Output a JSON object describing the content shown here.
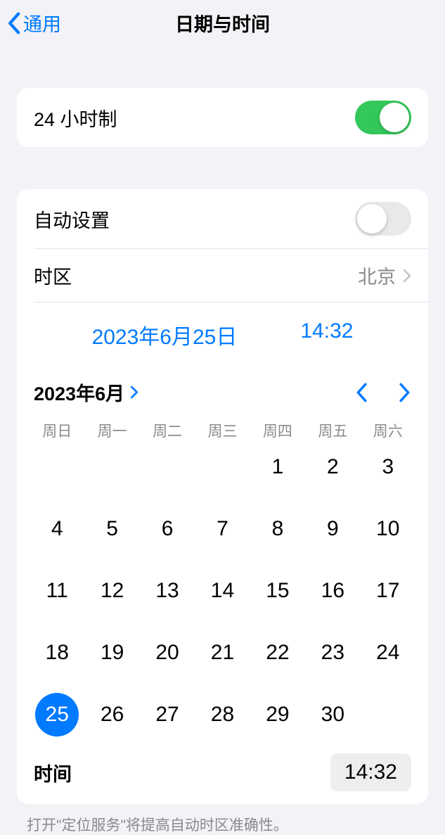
{
  "header": {
    "back_label": "通用",
    "title": "日期与时间"
  },
  "settings": {
    "clock24h_label": "24 小时制",
    "clock24h_on": true,
    "auto_set_label": "自动设置",
    "auto_set_on": false,
    "timezone_label": "时区",
    "timezone_value": "北京"
  },
  "datetime": {
    "date_display": "2023年6月25日",
    "time_display": "14:32"
  },
  "calendar": {
    "month_label": "2023年6月",
    "weekdays": [
      "周日",
      "周一",
      "周二",
      "周三",
      "周四",
      "周五",
      "周六"
    ],
    "leading_blanks": 4,
    "days_in_month": 30,
    "selected_day": 25
  },
  "time_row": {
    "label": "时间",
    "value": "14:32"
  },
  "footer": "打开\"定位服务\"将提高自动时区准确性。"
}
